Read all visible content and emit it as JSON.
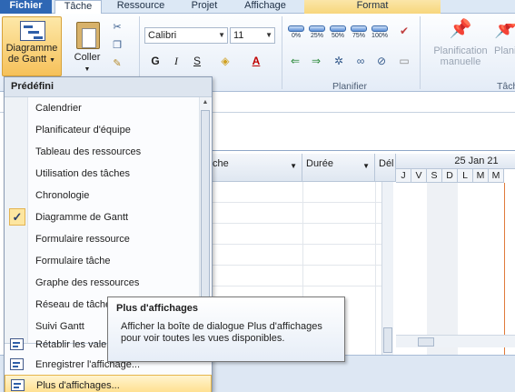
{
  "tabs": {
    "file": "Fichier",
    "task": "Tâche",
    "resource": "Ressource",
    "project": "Projet",
    "view": "Affichage",
    "format": "Format"
  },
  "ribbon": {
    "gantt_button": "Diagramme de Gantt",
    "paste_button": "Coller",
    "font_name": "Calibri",
    "font_size": "11",
    "bold": "G",
    "italic": "I",
    "underline": "S",
    "percent_labels": [
      "0%",
      "25%",
      "50%",
      "75%",
      "100%"
    ],
    "schedule_group": "Planifier",
    "manual_schedule": "Planification manuelle",
    "auto_schedule": "Planif auto",
    "tasks_group_partial": "Tâch"
  },
  "grid": {
    "col_name_partial": "che",
    "col_duration": "Durée",
    "col_start_partial": "Dél"
  },
  "gantt": {
    "week_label": "25 Jan 21",
    "days": [
      "J",
      "V",
      "S",
      "D",
      "L",
      "M",
      "M"
    ]
  },
  "menu": {
    "header": "Prédéfini",
    "items": [
      "Calendrier",
      "Planificateur d'équipe",
      "Tableau des ressources",
      "Utilisation des tâches",
      "Chronologie",
      "Diagramme de Gantt",
      "Formulaire ressource",
      "Formulaire tâche",
      "Graphe des ressources",
      "Réseau de tâches",
      "Suivi Gantt"
    ],
    "checked_item": "Diagramme de Gantt",
    "reset_view": "Rétablir les vale",
    "save_view": "Enregistrer l'affichage...",
    "more_views": "Plus d'affichages..."
  },
  "tooltip": {
    "title": "Plus d'affichages",
    "body": "Afficher la boîte de dialogue Plus d'affichages pour voir toutes les vues disponibles."
  },
  "colors": {
    "file_tab": "#2e67b4",
    "highlight": "#ffde8a",
    "today_line": "#e07b3a"
  }
}
